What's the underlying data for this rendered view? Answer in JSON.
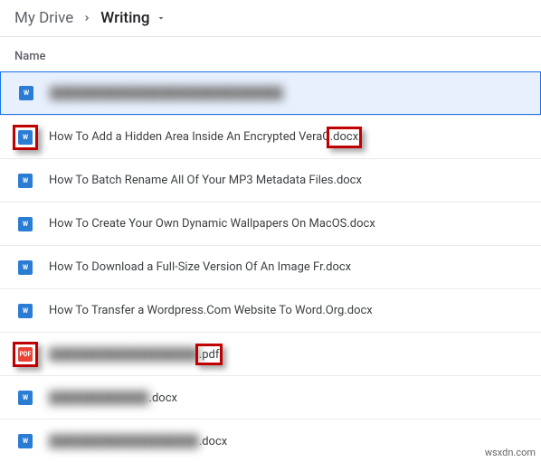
{
  "breadcrumb": {
    "root": "My Drive",
    "current": "Writing"
  },
  "column_header": "Name",
  "icons": {
    "word_glyph": "W",
    "pdf_glyph": "PDF"
  },
  "files": [
    {
      "type": "word",
      "name": "████████████████████████████",
      "blurred": true,
      "ext": "",
      "selected": true
    },
    {
      "type": "word",
      "name": "How To Add a Hidden Area Inside An Encrypted VeraC",
      "ext": ".docx",
      "annot_icon": true,
      "annot_ext": true
    },
    {
      "type": "word",
      "name": "How To Batch Rename All Of Your MP3 Metadata Files.docx",
      "ext": ""
    },
    {
      "type": "word",
      "name": "How To Create Your Own Dynamic Wallpapers On MacOS.docx",
      "ext": ""
    },
    {
      "type": "word",
      "name": "How To Download a Full-Size Version Of An Image Fr.docx",
      "ext": ""
    },
    {
      "type": "word",
      "name": "How To Transfer a Wordpress.Com Website To Word.Org.docx",
      "ext": ""
    },
    {
      "type": "pdf",
      "name": "██████████████████",
      "blurred": true,
      "ext": ".pdf",
      "annot_icon": true,
      "annot_ext": true
    },
    {
      "type": "word",
      "name": "████████████",
      "blurred": true,
      "ext": ".docx"
    },
    {
      "type": "word",
      "name": "██████████████████",
      "blurred": true,
      "ext": ".docx"
    }
  ],
  "watermark": "wsxdn.com"
}
